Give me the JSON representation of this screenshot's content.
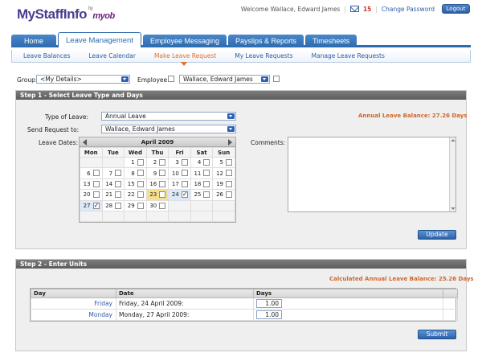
{
  "app": {
    "logo": "MyStaffInfo",
    "by": "by",
    "brand": "myob"
  },
  "header": {
    "welcome": "Welcome Wallace, Edward James",
    "message_count": "15",
    "change_password": "Change Password",
    "logout": "Logout"
  },
  "main_tabs": [
    {
      "label": "Home"
    },
    {
      "label": "Leave Management"
    },
    {
      "label": "Employee Messaging"
    },
    {
      "label": "Payslips & Reports"
    },
    {
      "label": "Timesheets"
    }
  ],
  "sub_tabs": [
    {
      "label": "Leave Balances"
    },
    {
      "label": "Leave Calendar"
    },
    {
      "label": "Make Leave Request"
    },
    {
      "label": "My Leave Requests"
    },
    {
      "label": "Manage Leave Requests"
    }
  ],
  "filters": {
    "group_label": "Group:",
    "group_value": "<My Details>",
    "employee_label": "Employee:",
    "employee_value": "Wallace, Edward James"
  },
  "step1": {
    "title": "Step 1 - Select Leave Type and Days",
    "type_label": "Type of Leave:",
    "type_value": "Annual Leave",
    "send_label": "Send Request to:",
    "send_value": "Wallace, Edward James",
    "dates_label": "Leave Dates:",
    "comments_label": "Comments:",
    "balance": "Annual Leave Balance: 27.26 Days",
    "update": "Update"
  },
  "calendar": {
    "month": "April 2009",
    "weekdays": [
      "Mon",
      "Tue",
      "Wed",
      "Thu",
      "Fri",
      "Sat",
      "Sun"
    ],
    "rows": [
      [
        "",
        "",
        "1",
        "2",
        "3",
        "4",
        "5"
      ],
      [
        "6",
        "7",
        "8",
        "9",
        "10",
        "11",
        "12"
      ],
      [
        "13",
        "14",
        "15",
        "16",
        "17",
        "18",
        "19"
      ],
      [
        "20",
        "21",
        "22",
        "23",
        "24",
        "25",
        "26"
      ],
      [
        "27",
        "28",
        "29",
        "30",
        "",
        "",
        ""
      ],
      [
        "",
        "",
        "",
        "",
        "",
        "",
        ""
      ]
    ],
    "today": "23",
    "checked": [
      "24",
      "27"
    ]
  },
  "step2": {
    "title": "Step 2 - Enter Units",
    "balance": "Calculated Annual Leave Balance: 25.26 Days",
    "columns": [
      "Day",
      "Date",
      "Days"
    ],
    "rows": [
      {
        "day": "Friday",
        "date": "Friday, 24 April 2009:",
        "days": "1.00"
      },
      {
        "day": "Monday",
        "date": "Monday, 27 April 2009:",
        "days": "1.00"
      }
    ],
    "submit": "Submit"
  }
}
